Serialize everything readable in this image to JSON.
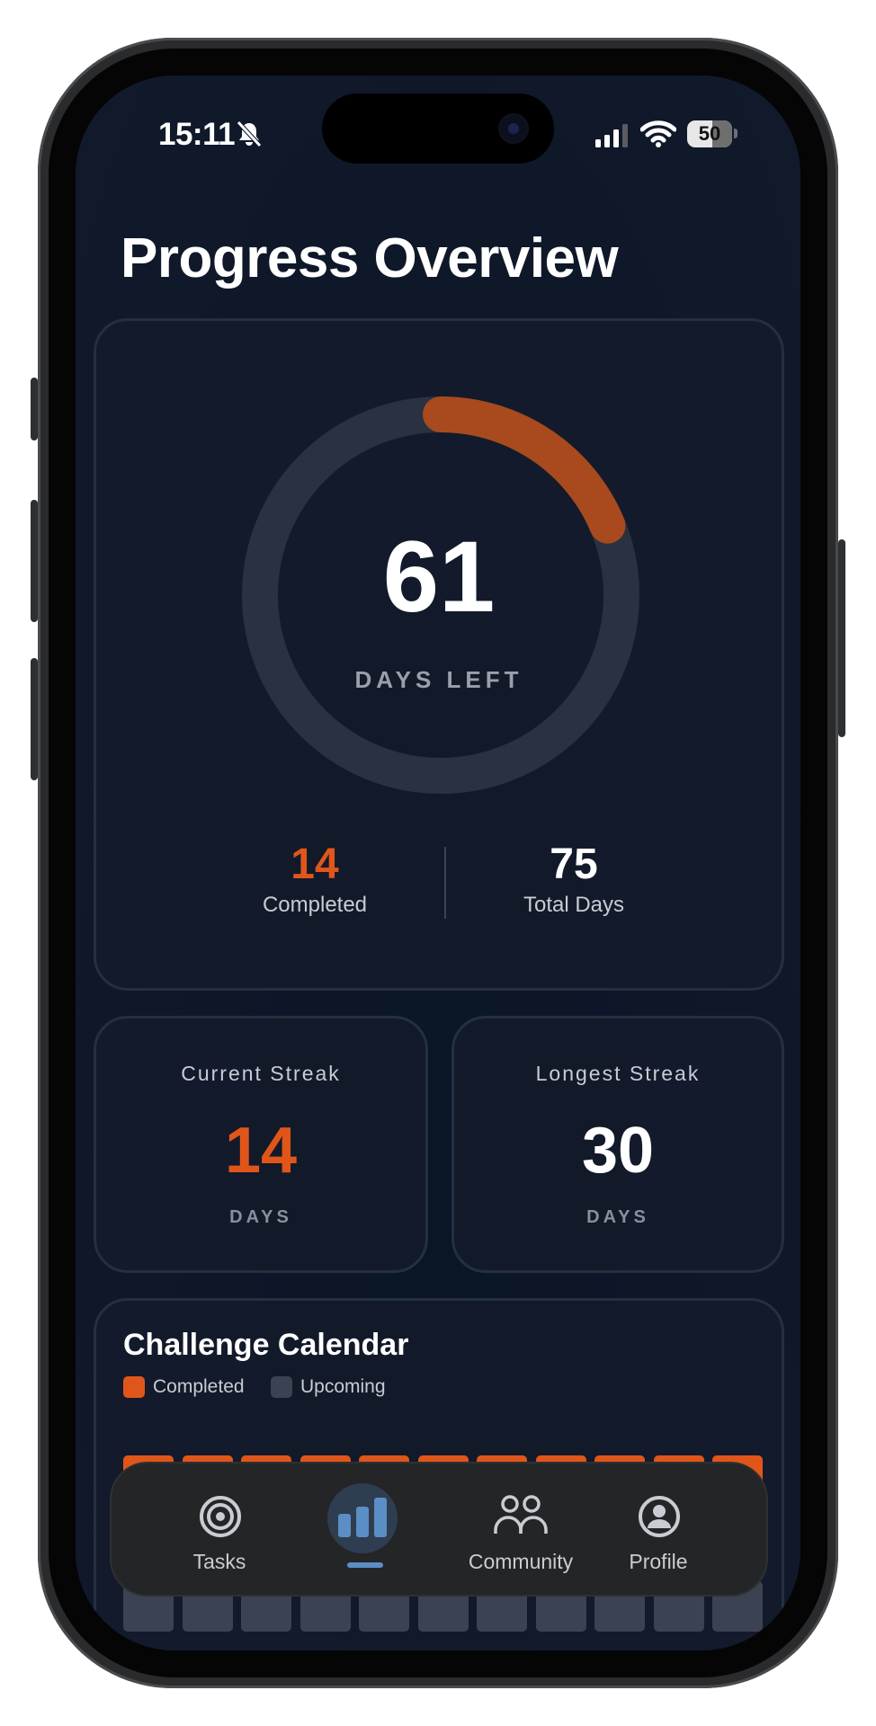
{
  "status_bar": {
    "time": "15:11",
    "battery": "50"
  },
  "page": {
    "title": "Progress Overview"
  },
  "progress": {
    "days_left": "61",
    "days_left_label": "DAYS LEFT",
    "completed_value": "14",
    "completed_label": "Completed",
    "total_value": "75",
    "total_label": "Total Days",
    "ring_progress_fraction": 0.187
  },
  "current_streak": {
    "title": "Current Streak",
    "value": "14",
    "unit": "DAYS"
  },
  "longest_streak": {
    "title": "Longest Streak",
    "value": "30",
    "unit": "DAYS"
  },
  "calendar": {
    "title": "Challenge Calendar",
    "legend": [
      {
        "label": "Completed",
        "color": "#e0561a"
      },
      {
        "label": "Upcoming",
        "color": "#3b4252"
      }
    ]
  },
  "tabs": [
    {
      "label": "Tasks",
      "icon": "target-icon"
    },
    {
      "label": "",
      "icon": "bar-chart-icon",
      "active": true
    },
    {
      "label": "Community",
      "icon": "people-icon"
    },
    {
      "label": "Profile",
      "icon": "person-circle-icon"
    }
  ],
  "colors": {
    "accent": "#e0561a",
    "ring_track": "#2a3140",
    "upcoming": "#3b4252"
  }
}
